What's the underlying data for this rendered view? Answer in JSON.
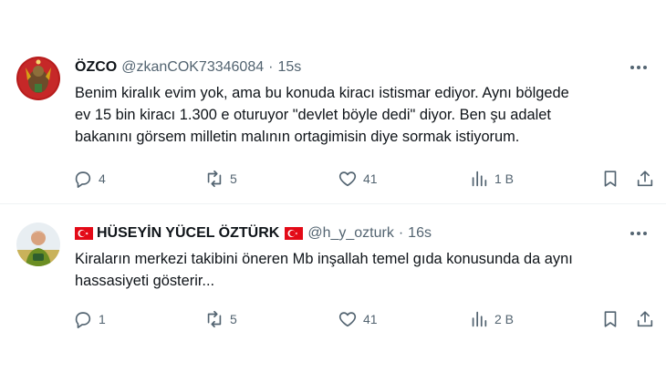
{
  "tweets": [
    {
      "name": "ÖZCO",
      "handle": "@zkanCOK73346084",
      "separator": "·",
      "time": "15s",
      "text": "Benim kiralık evim yok, ama bu konuda kiracı istismar ediyor. Aynı bölgede\nev 15 bin kiracı  1.300 e oturuyor \"devlet böyle dedi\" diyor.  Ben şu  adalet\nbakanını görsem milletin malının ortagimisin diye sormak istiyorum.",
      "reply_count": "4",
      "repost_count": "5",
      "like_count": "41",
      "view_count": "1 B"
    },
    {
      "name": "HÜSEYİN YÜCEL ÖZTÜRK",
      "handle": "@h_y_ozturk",
      "separator": "·",
      "time": "16s",
      "text": "Kiraların merkezi takibini öneren Mb inşallah temel gıda konusunda da aynı\nhassasiyeti gösterir...",
      "reply_count": "1",
      "repost_count": "5",
      "like_count": "41",
      "view_count": "2 B"
    }
  ],
  "colors": {
    "text_primary": "#0f1419",
    "text_secondary": "#536471",
    "divider": "#eff3f4",
    "flag_red": "#e30a17"
  },
  "icons": [
    "reply-icon",
    "repost-icon",
    "like-icon",
    "views-icon",
    "bookmark-icon",
    "share-icon",
    "more-icon",
    "turkish-flag-icon"
  ]
}
